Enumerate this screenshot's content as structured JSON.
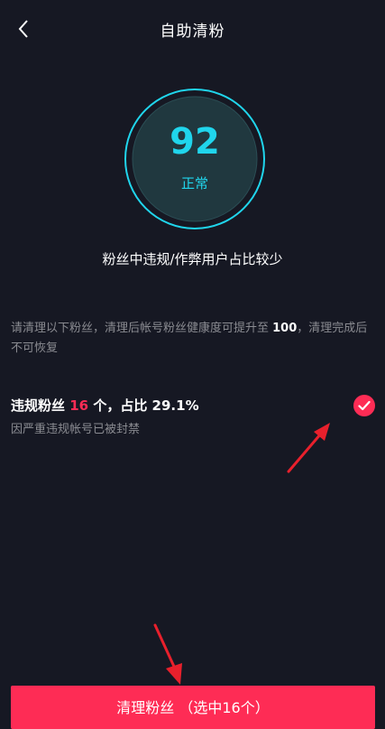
{
  "header": {
    "title": "自助清粉",
    "back_icon": "chevron-left-icon"
  },
  "score": {
    "value": "92",
    "status": "正常",
    "ring_color": "#20d5ec"
  },
  "summary": "粉丝中违规/作弊用户占比较少",
  "notice": {
    "prefix": "请清理以下粉丝，清理后帐号粉丝健康度可提升至 ",
    "value": "100",
    "suffix": "，清理完成后不可恢复"
  },
  "violation": {
    "label_before": "违规粉丝 ",
    "count": "16",
    "label_after": " 个，占比 29.1%",
    "subtitle": "因严重违规帐号已被封禁",
    "checked": true,
    "check_icon": "check-icon"
  },
  "footer": {
    "button_label": "清理粉丝 （选中16个）"
  },
  "colors": {
    "background": "#161823",
    "accent": "#fe2c55",
    "cyan": "#20d5ec",
    "annotation": "#e8202c"
  }
}
